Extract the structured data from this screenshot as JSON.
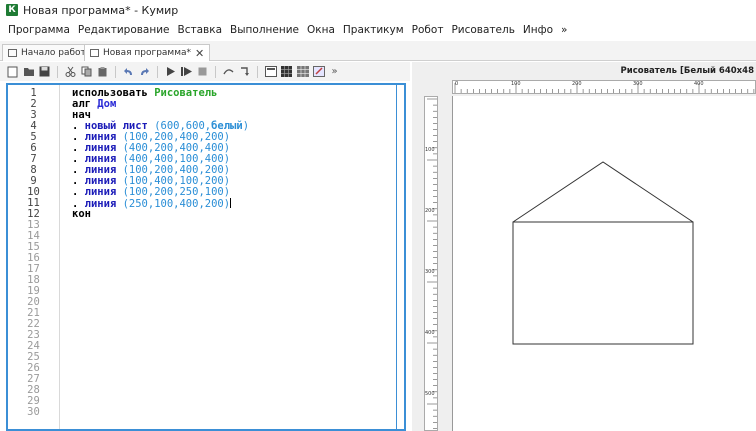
{
  "window": {
    "title": "Новая программа* - Кумир",
    "app_icon": "К"
  },
  "menu": [
    "Программа",
    "Редактирование",
    "Вставка",
    "Выполнение",
    "Окна",
    "Практикум",
    "Робот",
    "Рисователь",
    "Инфо",
    "»"
  ],
  "tabs": [
    {
      "label": "Начало работы",
      "icon": "window-icon",
      "active": false
    },
    {
      "label": "Новая программа*",
      "icon": "program-icon",
      "active": true,
      "close": "✕"
    }
  ],
  "toolbar": {
    "more": "»"
  },
  "editor": {
    "line_numbers": [
      "1",
      "2",
      "3",
      "4",
      "5",
      "6",
      "7",
      "8",
      "9",
      "10",
      "11",
      "12",
      "13",
      "14",
      "15",
      "16",
      "17",
      "18",
      "19",
      "20",
      "21",
      "22",
      "23",
      "24",
      "25",
      "26",
      "27",
      "28",
      "29",
      "30"
    ],
    "line1": {
      "kw": "использовать",
      "module": "Рисователь"
    },
    "line2": {
      "kw": "алг",
      "name": "Дом"
    },
    "line3": {
      "kw": "нач"
    },
    "line4": {
      "dot": ". ",
      "func": "новый лист",
      "args": " (600,600,",
      "lit": "белый",
      "close": ")"
    },
    "line5": {
      "dot": ". ",
      "func": "линия",
      "args": " (100,200,400,200)"
    },
    "line6": {
      "dot": ". ",
      "func": "линия",
      "args": " (400,200,400,400)"
    },
    "line7": {
      "dot": ". ",
      "func": "линия",
      "args": " (400,400,100,400)"
    },
    "line8": {
      "dot": ". ",
      "func": "линия",
      "args": " (100,200,400,200)"
    },
    "line9": {
      "dot": ". ",
      "func": "линия",
      "args": " (100,400,100,200)"
    },
    "line10": {
      "dot": ". ",
      "func": "линия",
      "args": " (100,200,250,100)"
    },
    "line11": {
      "dot": ". ",
      "func": "линия",
      "args": " (250,100,400,200)"
    },
    "line12": {
      "kw": "кон"
    }
  },
  "painter": {
    "title": "Рисователь [Белый 640x48",
    "hruler_labels": [
      "0",
      "100",
      "200",
      "300",
      "400"
    ],
    "vruler_labels": [
      "100",
      "200",
      "300",
      "400",
      "500"
    ]
  }
}
